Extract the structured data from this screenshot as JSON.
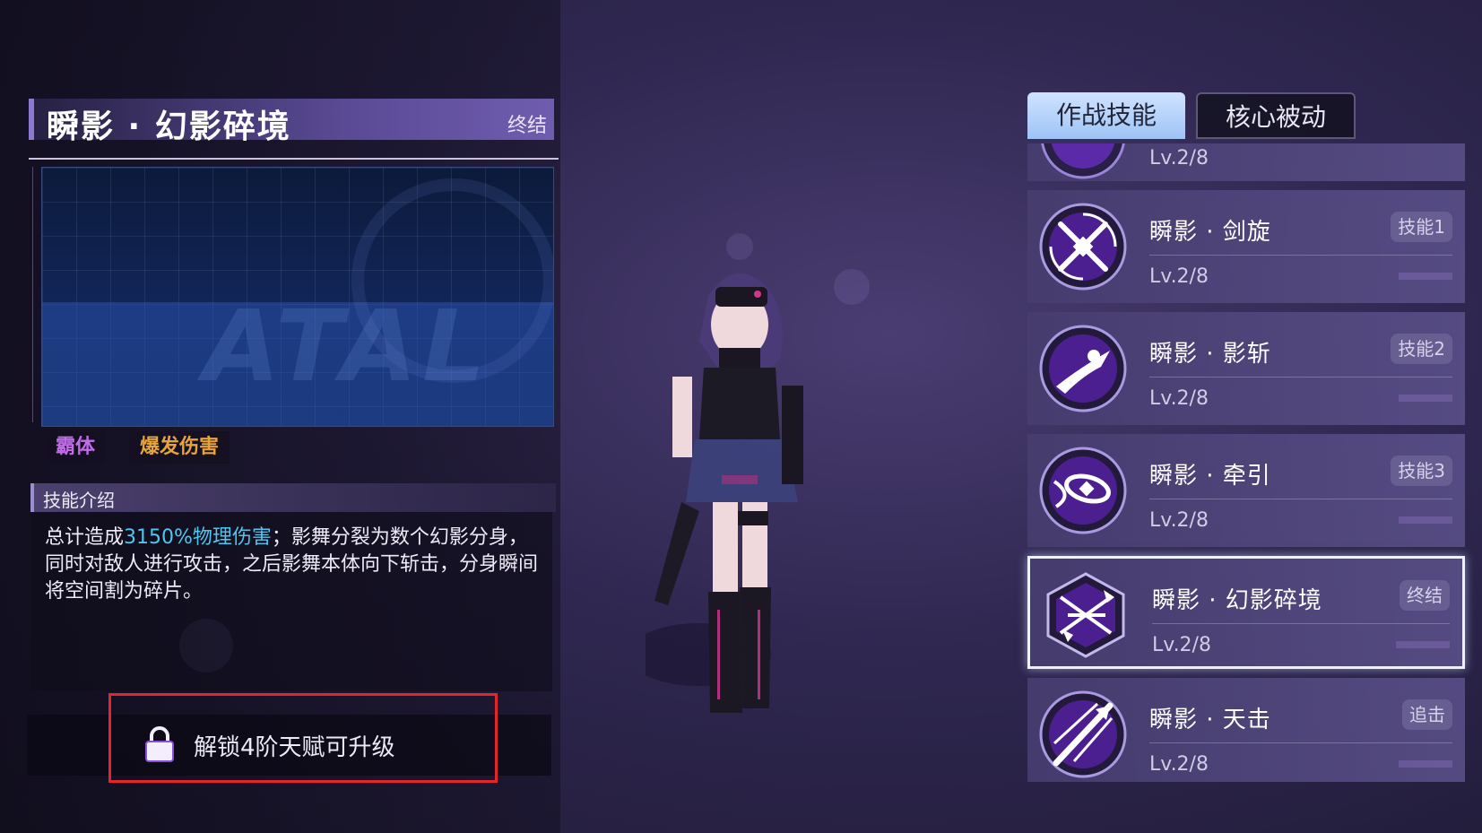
{
  "skill_detail": {
    "title": "瞬影 · 幻影碎境",
    "type_tag": "终结",
    "tags": [
      "霸体",
      "爆发伤害"
    ],
    "intro_header": "技能介绍",
    "intro_before": "总计造成",
    "intro_highlight": "3150%物理伤害",
    "intro_after": "；影舞分裂为数个幻影分身，同时对敌人进行攻击，之后影舞本体向下斩击，分身瞬间将空间割为碎片。",
    "unlock_text": "解锁4阶天赋可升级",
    "preview_watermark": "ATAL"
  },
  "tabs": {
    "combat": "作战技能",
    "passive": "核心被动"
  },
  "skills_list": {
    "partial_top_level": "Lv.2/8",
    "items": [
      {
        "name": "瞬影 · 剑旋",
        "badge": "技能1",
        "level": "Lv.2/8"
      },
      {
        "name": "瞬影 · 影斩",
        "badge": "技能2",
        "level": "Lv.2/8"
      },
      {
        "name": "瞬影 · 牵引",
        "badge": "技能3",
        "level": "Lv.2/8"
      },
      {
        "name": "瞬影 · 幻影碎境",
        "badge": "终结",
        "level": "Lv.2/8"
      },
      {
        "name": "瞬影 · 天击",
        "badge": "追击",
        "level": "Lv.2/8"
      }
    ],
    "selected_index": 3
  },
  "colors": {
    "highlight": "#4fc6f0",
    "tag_purple": "#c06ee8",
    "tag_orange": "#e7a43a",
    "unlock_frame": "#e3262c",
    "tab_active": "#b8d6fb"
  }
}
